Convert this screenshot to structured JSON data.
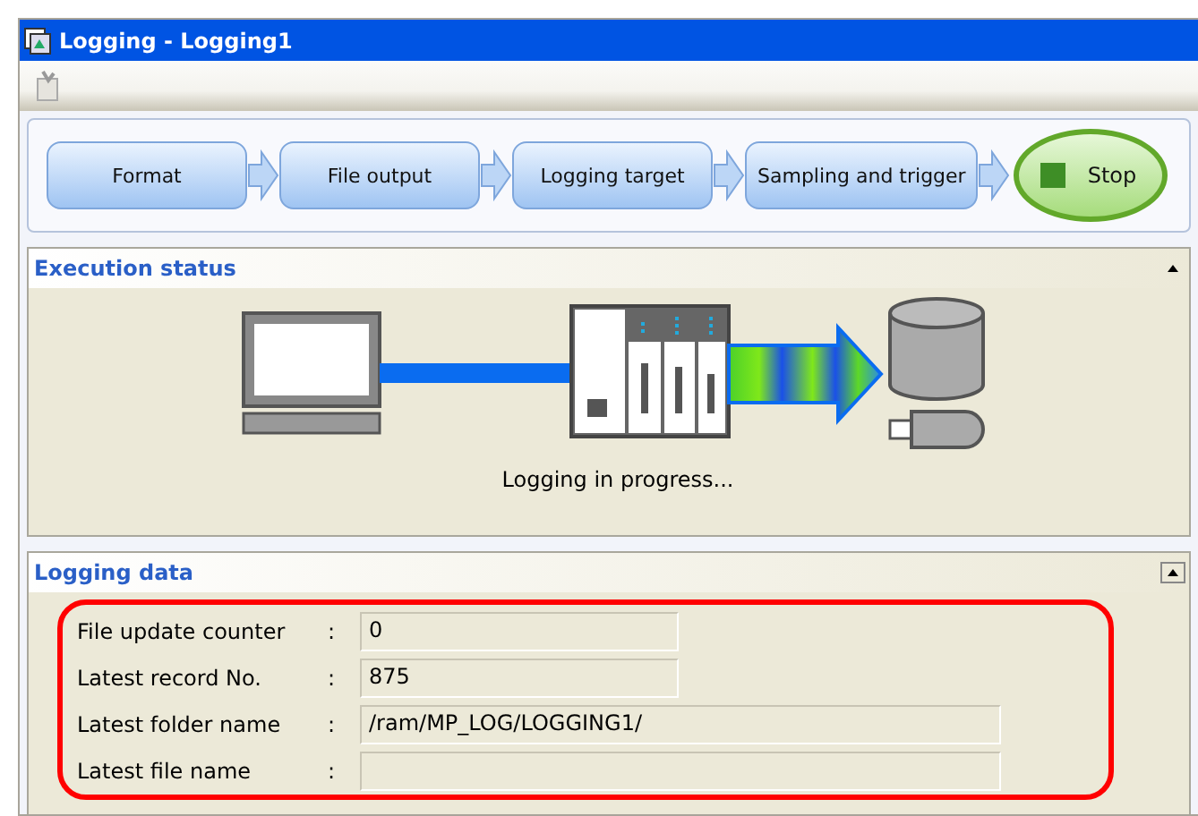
{
  "window": {
    "title": "Logging - Logging1"
  },
  "steps": [
    {
      "label": "Format"
    },
    {
      "label": "File output"
    },
    {
      "label": "Logging target"
    },
    {
      "label": "Sampling and trigger"
    }
  ],
  "stop_button": {
    "label": "Stop"
  },
  "execution_status": {
    "title": "Execution status",
    "message": "Logging in progress..."
  },
  "logging_data": {
    "title": "Logging data",
    "fields": [
      {
        "label": "File update counter",
        "separator": ":",
        "value": "0",
        "kind": "short"
      },
      {
        "label": "Latest record No.",
        "separator": ":",
        "value": "875",
        "kind": "short"
      },
      {
        "label": "Latest folder name",
        "separator": ":",
        "value": "/ram/MP_LOG/LOGGING1/",
        "kind": "long"
      },
      {
        "label": "Latest file name",
        "separator": ":",
        "kind": "long"
      }
    ]
  }
}
